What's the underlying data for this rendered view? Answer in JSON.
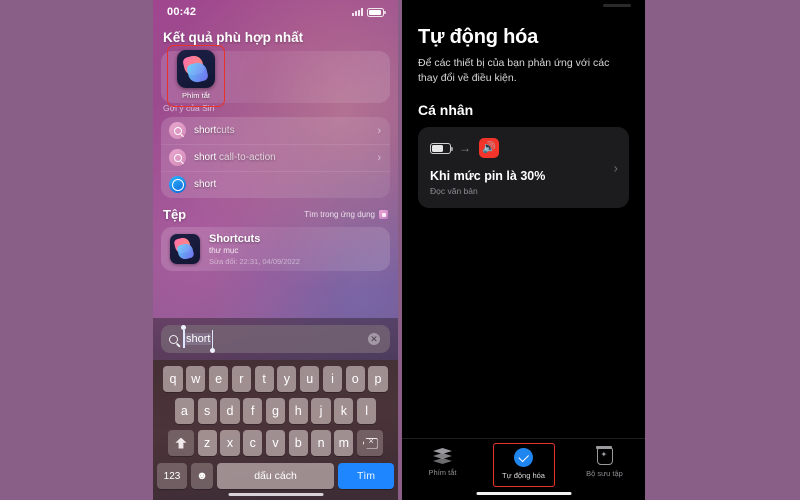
{
  "background_color": "#8a5f87",
  "left_phone": {
    "status_bar": {
      "time": "00:42",
      "signal_icon": "signal-bars-icon",
      "battery_icon": "battery-icon"
    },
    "best_match": {
      "section_title": "Kết quả phù hợp nhất",
      "app_label": "Phím tắt",
      "app_icon": "shortcuts-app-icon",
      "highlight_color": "#e8322a"
    },
    "siri": {
      "section_label": "Gợi ý của Siri",
      "rows": [
        {
          "icon": "search-icon",
          "text_bold": "short",
          "text_rest": "cuts",
          "chevron": "›"
        },
        {
          "icon": "search-icon",
          "text_bold": "short",
          "text_rest": " call-to-action",
          "chevron": "›"
        },
        {
          "icon": "safari-icon",
          "text_bold": "short",
          "text_rest": "",
          "chevron": ""
        }
      ]
    },
    "files": {
      "section_title": "Tệp",
      "find_in_app_label": "Tìm trong ứng dụng",
      "find_in_app_icon": "app-store-icon",
      "item": {
        "icon": "shortcuts-folder-icon",
        "title": "Shortcuts",
        "subtitle": "thư mục",
        "modified": "Sửa đổi: 22:31, 04/09/2022"
      }
    },
    "search": {
      "icon": "search-icon",
      "value": "short",
      "clear_icon": "clear-circle-icon",
      "clear_glyph": "✕"
    },
    "keyboard": {
      "row1": [
        "q",
        "w",
        "e",
        "r",
        "t",
        "y",
        "u",
        "i",
        "o",
        "p"
      ],
      "row2": [
        "a",
        "s",
        "d",
        "f",
        "g",
        "h",
        "j",
        "k",
        "l"
      ],
      "row3": [
        "z",
        "x",
        "c",
        "v",
        "b",
        "n",
        "m"
      ],
      "shift_icon": "shift-icon",
      "delete_icon": "delete-icon",
      "numbers_key": "123",
      "emoji_icon": "emoji-icon",
      "emoji_glyph": "☻",
      "space_key": "dấu cách",
      "go_key": "Tìm",
      "go_key_color": "#1e86ff"
    }
  },
  "right_phone": {
    "title": "Tự động hóa",
    "description": "Để các thiết bị của bạn phản ứng với các thay đổi về điều kiện.",
    "section_title": "Cá nhân",
    "automation": {
      "trigger_icon": "battery-icon",
      "arrow_icon": "arrow-right-icon",
      "action_icon": "speaker-icon",
      "action_icon_color": "#f2342a",
      "speaker_glyph": "🔊",
      "title": "Khi mức pin là 30%",
      "subtitle": "Đọc văn bản",
      "chevron": "›"
    },
    "tabs": [
      {
        "icon": "layers-icon",
        "label": "Phím tắt",
        "active": false
      },
      {
        "icon": "check-circle-icon",
        "label": "Tự động hóa",
        "active": true
      },
      {
        "icon": "jar-icon",
        "label": "Bộ sưu tập",
        "active": false
      }
    ],
    "tab_highlight_color": "#e8322a"
  }
}
